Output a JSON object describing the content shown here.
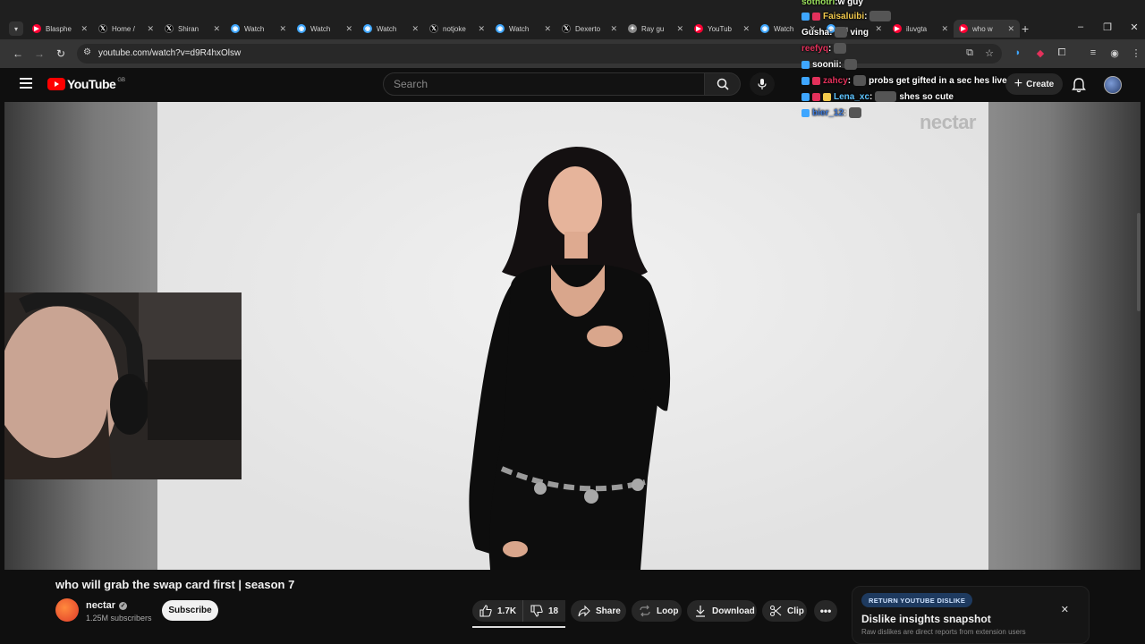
{
  "browser": {
    "tabs": [
      {
        "title": "Blasphe",
        "fav": "youtube",
        "color": "#ff0033"
      },
      {
        "title": "Home /",
        "fav": "x",
        "color": "#000000"
      },
      {
        "title": "Shiran",
        "fav": "x",
        "color": "#000000"
      },
      {
        "title": "Watch",
        "fav": "watch",
        "color": "#3ea6ff"
      },
      {
        "title": "Watch",
        "fav": "watch",
        "color": "#3ea6ff"
      },
      {
        "title": "Watch",
        "fav": "watch",
        "color": "#3ea6ff"
      },
      {
        "title": "notjoke",
        "fav": "x",
        "color": "#000000"
      },
      {
        "title": "Watch",
        "fav": "watch",
        "color": "#3ea6ff"
      },
      {
        "title": "Dexerto",
        "fav": "x",
        "color": "#000000"
      },
      {
        "title": "Ray gu",
        "fav": "generic",
        "color": "#888888"
      },
      {
        "title": "YouTub",
        "fav": "youtube",
        "color": "#ff0033"
      },
      {
        "title": "Watch",
        "fav": "watch",
        "color": "#3ea6ff"
      },
      {
        "title": "ng",
        "fav": "watch",
        "color": "#3ea6ff"
      },
      {
        "title": "iluvgta",
        "fav": "youtube",
        "color": "#ff0033"
      },
      {
        "title": "who w",
        "fav": "youtube",
        "color": "#ff0033",
        "active": true
      }
    ],
    "url": "youtube.com/watch?v=d9R4hxOlsw"
  },
  "youtube": {
    "logo_text": "YouTube",
    "country_code": "GB",
    "search_placeholder": "Search",
    "create_label": "Create"
  },
  "video": {
    "watermark": "nectar",
    "title": "who will grab the swap card first | season 7",
    "channel": "nectar",
    "subscribers": "1.25M subscribers",
    "subscribe_label": "Subscribe",
    "likes": "1.7K",
    "dislikes": "18",
    "share_label": "Share",
    "loop_label": "Loop",
    "download_label": "Download",
    "clip_label": "Clip"
  },
  "chat": [
    {
      "user": "sothotri",
      "color": "#9be15d",
      "text": "w guy",
      "badges": 0
    },
    {
      "user": "Faisaluibi",
      "color": "#f2c94c",
      "text": "",
      "badges": 2,
      "emote": "wide"
    },
    {
      "user": "Gusha",
      "color": "#ffffff",
      "text": "ving",
      "badges": 0,
      "emote": "small"
    },
    {
      "user": "reefyq",
      "color": "#e3315b",
      "text": "",
      "badges": 0,
      "emote": "small"
    },
    {
      "user": "soonii",
      "color": "#ffffff",
      "text": "",
      "badges": 1,
      "emote": "small"
    },
    {
      "user": "zahcy",
      "color": "#e3315b",
      "text": "probs get gifted in a sec hes live",
      "badges": 2,
      "emote": "small"
    },
    {
      "user": "Lena_xc",
      "color": "#5ec4ff",
      "text": "shes so cute",
      "badges": 3,
      "emote": "wide"
    },
    {
      "user": "bier_12",
      "color": "#3f7ad9",
      "text": "",
      "badges": 1,
      "emote": "small"
    }
  ],
  "dislike_panel": {
    "tag": "RETURN YOUTUBE DISLIKE",
    "heading": "Dislike insights snapshot",
    "subtext": "Raw dislikes are direct reports from extension users"
  }
}
